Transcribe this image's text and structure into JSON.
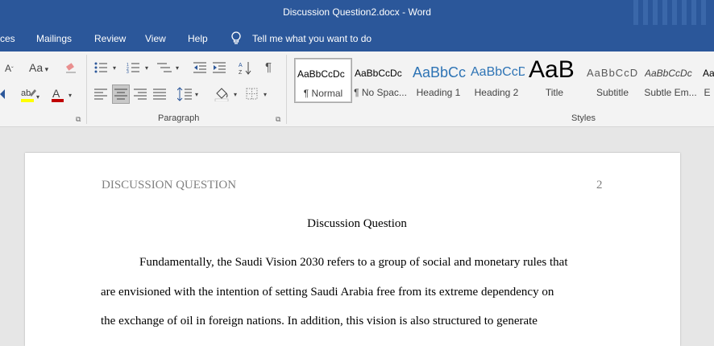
{
  "window": {
    "title": "Discussion Question2.docx  -  Word"
  },
  "menu": {
    "references_partial": "ces",
    "mailings": "Mailings",
    "review": "Review",
    "view": "View",
    "help": "Help",
    "tell_me": "Tell me what you want to do"
  },
  "ribbon": {
    "font": {
      "case_label": "Aa",
      "font_color_letter": "A",
      "size_letter": "A"
    },
    "paragraph": {
      "label": "Paragraph"
    },
    "styles": {
      "label": "Styles",
      "items": [
        {
          "sample": "AaBbCcDc",
          "name": "¶ Normal",
          "color": "#000000"
        },
        {
          "sample": "AaBbCcDc",
          "name": "¶ No Spac...",
          "color": "#000000"
        },
        {
          "sample": "AaBbCc",
          "name": "Heading 1",
          "color": "#2e74b5"
        },
        {
          "sample": "AaBbCcD",
          "name": "Heading 2",
          "color": "#2e74b5"
        },
        {
          "sample": "AaB",
          "name": "Title",
          "color": "#000000"
        },
        {
          "sample": "AaBbCcD",
          "name": "Subtitle",
          "color": "#595959"
        },
        {
          "sample": "AaBbCcDc",
          "name": "Subtle Em...",
          "color": "#404040"
        },
        {
          "sample": "Aa",
          "name": "E",
          "color": "#000000"
        }
      ]
    }
  },
  "document": {
    "header_left": "DISCUSSION QUESTION",
    "page_number": "2",
    "title": "Discussion Question",
    "lines": [
      "Fundamentally, the Saudi Vision 2030 refers to a group of social and monetary rules that",
      "are envisioned with the intention of setting Saudi Arabia free from its extreme dependency on",
      "the exchange of oil in foreign nations. In addition, this vision is also structured to generate"
    ]
  },
  "colors": {
    "accent": "#2b579a",
    "highlight": "#ffff00",
    "font_red": "#c00000",
    "heading_blue": "#2e74b5"
  }
}
